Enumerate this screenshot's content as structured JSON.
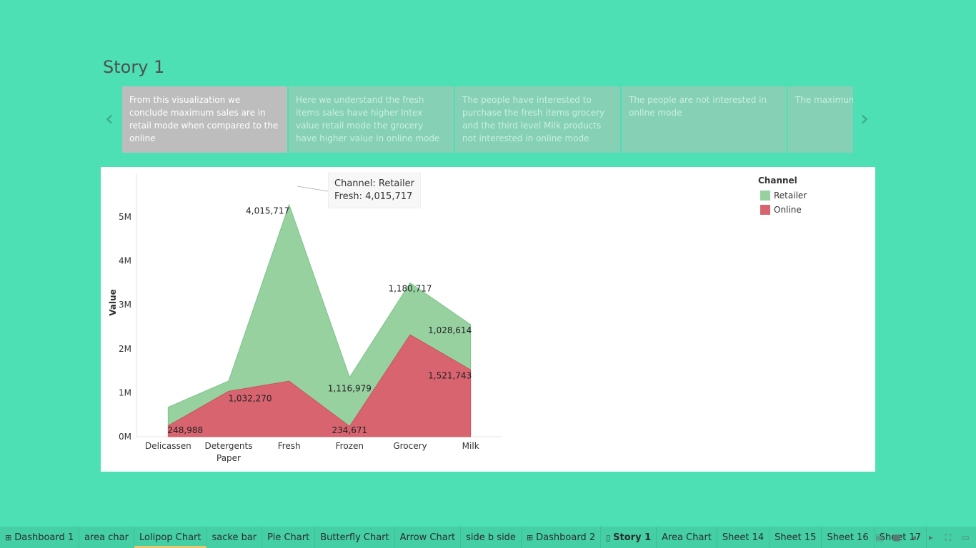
{
  "story": {
    "title": "Story 1",
    "prev_label": "‹",
    "next_label": "›"
  },
  "story_points": [
    {
      "text": "From this visualization we conclude maximum sales are in retail mode when compared to the online",
      "active": true
    },
    {
      "text": "Here we understand the fresh items sales have higher Intex value retail mode the grocery have higher value in online mode",
      "active": false
    },
    {
      "text": "The people have interested to purchase the fresh items grocery and the third level Milk products not interested in online mode",
      "active": false
    },
    {
      "text": "The people are not interested in online mode",
      "active": false
    },
    {
      "text": "The maximum ... when compare...",
      "active": false
    }
  ],
  "tooltip": {
    "line1": "Channel: Retailer",
    "line2": "Fresh: 4,015,717"
  },
  "legend": {
    "title": "Channel",
    "items": [
      "Retailer",
      "Online"
    ]
  },
  "chart_data": {
    "type": "area",
    "stacked": true,
    "categories": [
      "Delicassen",
      "Detergents Paper",
      "Fresh",
      "Frozen",
      "Grocery",
      "Milk"
    ],
    "series": [
      {
        "name": "Online",
        "color": "#d7646f",
        "values": [
          248988,
          1032270,
          1264414,
          234671,
          2317845,
          1521743
        ]
      },
      {
        "name": "Retailer",
        "color": "#97d1a0",
        "values": [
          421955,
          235587,
          4015717,
          1116979,
          1180717,
          1028614
        ]
      }
    ],
    "labels": [
      "248,988",
      "1,032,270",
      "4,015,717",
      "234,671",
      "1,116,979",
      "1,180,717",
      "1,028,614",
      "1,521,743"
    ],
    "ylabel": "Value",
    "yticks": [
      "0M",
      "1M",
      "2M",
      "3M",
      "4M",
      "5M"
    ],
    "ylim": [
      0,
      5500000
    ]
  },
  "tabs": [
    {
      "label": "Dashboard 1",
      "icon": "dashboard-icon"
    },
    {
      "label": "area char",
      "icon": ""
    },
    {
      "label": "Lolipop Chart",
      "icon": ""
    },
    {
      "label": "sacke bar",
      "icon": ""
    },
    {
      "label": "Pie Chart",
      "icon": ""
    },
    {
      "label": "Butterfly Chart",
      "icon": ""
    },
    {
      "label": "Arrow Chart",
      "icon": ""
    },
    {
      "label": "side b side",
      "icon": ""
    },
    {
      "label": "Dashboard 2",
      "icon": "dashboard-icon"
    },
    {
      "label": "Story 1",
      "icon": "story-icon"
    },
    {
      "label": "Area Chart",
      "icon": ""
    },
    {
      "label": "Sheet 14",
      "icon": ""
    },
    {
      "label": "Sheet 15",
      "icon": ""
    },
    {
      "label": "Sheet 16",
      "icon": ""
    },
    {
      "label": "Sheet 17",
      "icon": ""
    }
  ]
}
